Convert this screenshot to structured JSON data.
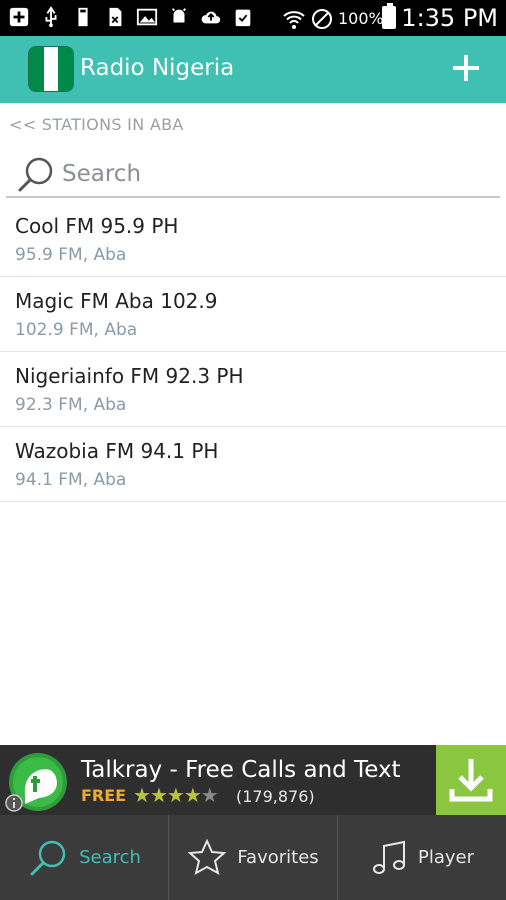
{
  "status_bar": {
    "battery_percent": "100%",
    "time": "1:35 PM"
  },
  "app_bar": {
    "title": "Radio Nigeria",
    "add_label": "+"
  },
  "breadcrumb": "<< STATIONS IN ABA",
  "search": {
    "placeholder": "Search",
    "value": ""
  },
  "stations": [
    {
      "name": "Cool FM 95.9 PH",
      "sub": "95.9 FM, Aba"
    },
    {
      "name": "Magic FM Aba 102.9",
      "sub": "102.9 FM, Aba"
    },
    {
      "name": "Nigeriainfo FM 92.3 PH",
      "sub": "92.3 FM, Aba"
    },
    {
      "name": "Wazobia FM 94.1 PH",
      "sub": "94.1 FM, Aba"
    }
  ],
  "ad": {
    "title": "Talkray - Free Calls and Text",
    "price": "FREE",
    "rating": 4,
    "rating_max": 5,
    "reviews": "(179,876)"
  },
  "bottom_nav": {
    "tabs": [
      {
        "label": "Search",
        "icon": "search-icon",
        "active": true
      },
      {
        "label": "Favorites",
        "icon": "star-icon",
        "active": false
      },
      {
        "label": "Player",
        "icon": "music-note-icon",
        "active": false
      }
    ]
  },
  "colors": {
    "accent": "#3fc0b3",
    "ad_download": "#8ac640",
    "nav_bg": "#3b3b3b"
  }
}
